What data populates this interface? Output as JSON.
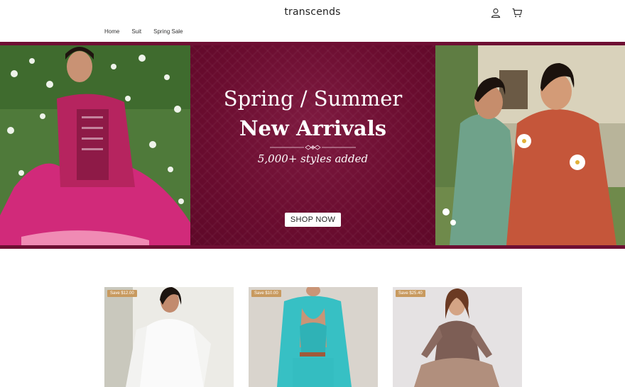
{
  "header": {
    "logo": "transcends",
    "icons": [
      "account-icon",
      "cart-icon"
    ]
  },
  "nav": {
    "items": [
      "Home",
      "Suit",
      "Spring Sale"
    ]
  },
  "hero": {
    "title_line1": "Spring / Summer",
    "title_line2": "New Arrivals",
    "subtitle": "5,000+ styles added",
    "cta": "SHOP NOW",
    "colors": {
      "background": "#6e0f33",
      "badge": "#c89a5f"
    }
  },
  "products": [
    {
      "badge": "Save $12.00"
    },
    {
      "badge": "Save $10.00"
    },
    {
      "badge": "Save $25.40"
    }
  ]
}
